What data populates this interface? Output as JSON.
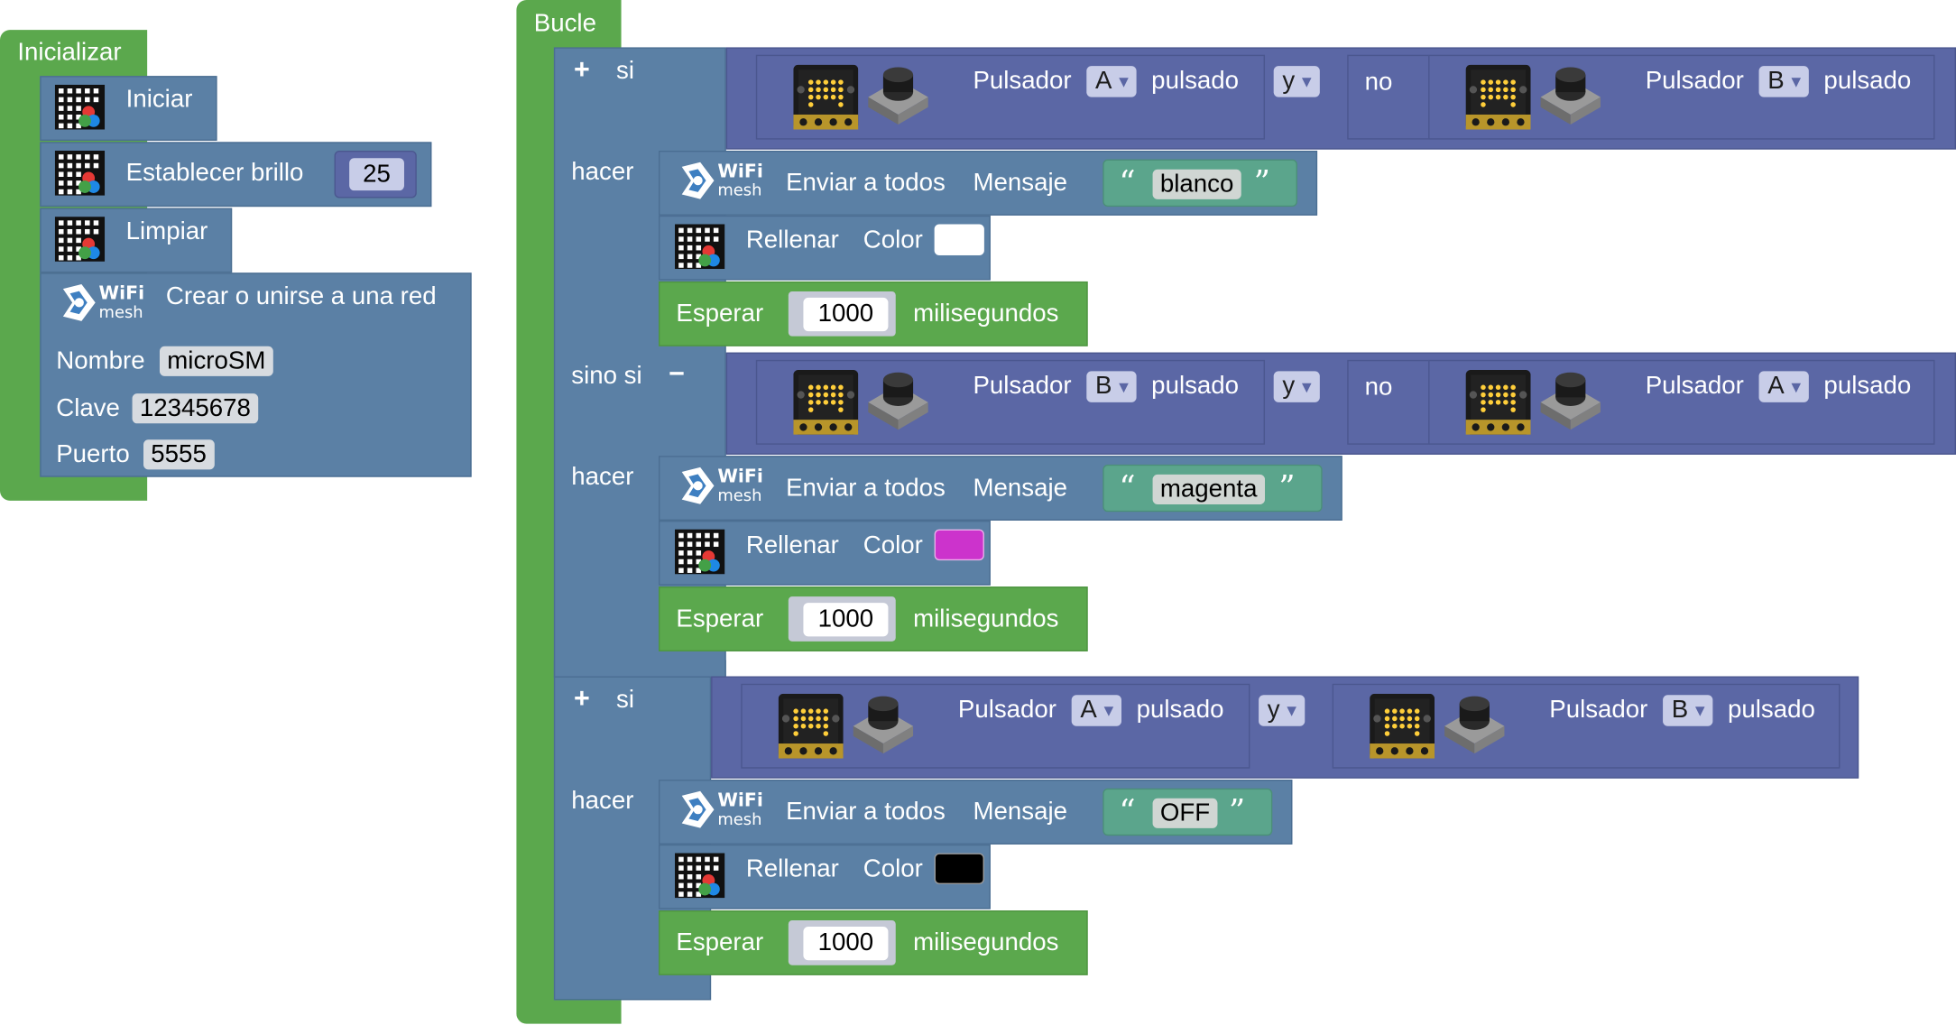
{
  "colors": {
    "green": "#5ba84d",
    "blue": "#5b80a5",
    "purple": "#5b67a5",
    "teal": "#5ba58c",
    "white": "#ffffff",
    "magenta": "#cc33cc",
    "black": "#000000"
  },
  "init": {
    "title": "Inicializar",
    "iniciar": "Iniciar",
    "brillo_label": "Establecer brillo",
    "brillo_value": "25",
    "limpiar": "Limpiar",
    "wifi_brand_top": "WiFi",
    "wifi_brand_bottom": "mesh",
    "crear": "Crear o unirse a una red",
    "nombre_label": "Nombre",
    "nombre_value": "microSM",
    "clave_label": "Clave",
    "clave_value": "12345678",
    "puerto_label": "Puerto",
    "puerto_value": "5555"
  },
  "loop": {
    "title": "Bucle",
    "if1": {
      "plus": "+",
      "si": "si",
      "left_label": "Pulsador",
      "left_button": "A",
      "left_suffix": "pulsado",
      "and": "y",
      "not": "no",
      "right_label": "Pulsador",
      "right_button": "B",
      "right_suffix": "pulsado",
      "hacer": "hacer",
      "send_label": "Enviar a todos",
      "msg_label": "Mensaje",
      "message": "blanco",
      "fill_label": "Rellenar",
      "color_label": "Color",
      "wait_label": "Esperar",
      "wait_value": "1000",
      "wait_unit": "milisegundos",
      "elseif": "sino si",
      "minus": "−",
      "left_label2": "Pulsador",
      "left_button2": "B",
      "left_suffix2": "pulsado",
      "and2": "y",
      "not2": "no",
      "right_label2": "Pulsador",
      "right_button2": "A",
      "right_suffix2": "pulsado",
      "hacer2": "hacer",
      "send_label2": "Enviar a todos",
      "msg_label2": "Mensaje",
      "message2": "magenta",
      "fill_label2": "Rellenar",
      "color_label2": "Color",
      "wait_label2": "Esperar",
      "wait_value2": "1000",
      "wait_unit2": "milisegundos"
    },
    "if2": {
      "plus": "+",
      "si": "si",
      "left_label": "Pulsador",
      "left_button": "A",
      "left_suffix": "pulsado",
      "and": "y",
      "right_label": "Pulsador",
      "right_button": "B",
      "right_suffix": "pulsado",
      "hacer": "hacer",
      "send_label": "Enviar a todos",
      "msg_label": "Mensaje",
      "message": "OFF",
      "fill_label": "Rellenar",
      "color_label": "Color",
      "wait_label": "Esperar",
      "wait_value": "1000",
      "wait_unit": "milisegundos"
    }
  },
  "dropdown_arrow": "▼",
  "quote_open": "“",
  "quote_close": "”"
}
